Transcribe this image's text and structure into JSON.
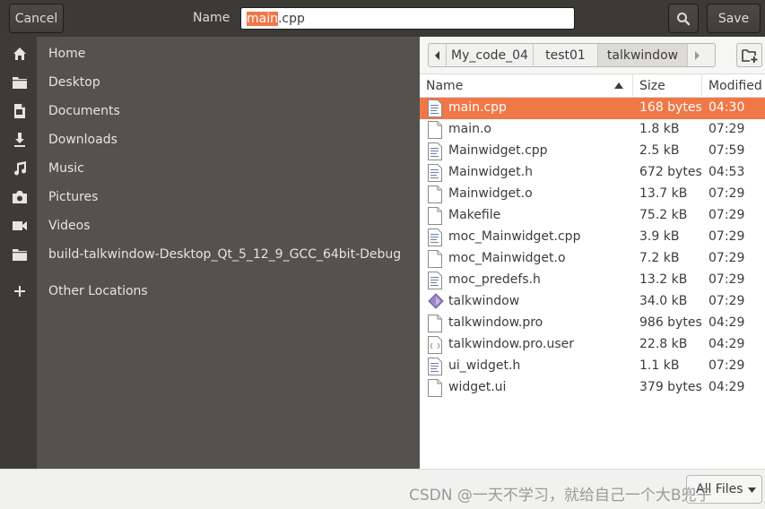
{
  "header": {
    "cancel_label": "Cancel",
    "name_label": "Name",
    "filename_selected": "main",
    "filename_rest": ".cpp",
    "save_label": "Save"
  },
  "sidebar": {
    "items": [
      {
        "label": "Home",
        "icon": "home-icon"
      },
      {
        "label": "Desktop",
        "icon": "folder-icon"
      },
      {
        "label": "Documents",
        "icon": "document-icon"
      },
      {
        "label": "Downloads",
        "icon": "download-icon"
      },
      {
        "label": "Music",
        "icon": "music-icon"
      },
      {
        "label": "Pictures",
        "icon": "camera-icon"
      },
      {
        "label": "Videos",
        "icon": "video-icon"
      },
      {
        "label": "build-talkwindow-Desktop_Qt_5_12_9_GCC_64bit-Debug",
        "icon": "folder-icon"
      },
      {
        "label": "Other Locations",
        "icon": "plus-icon"
      }
    ]
  },
  "pathbar": {
    "crumbs": [
      "My_code_04",
      "test01",
      "talkwindow"
    ],
    "active": "talkwindow"
  },
  "columns": {
    "name": "Name",
    "size": "Size",
    "modified": "Modified"
  },
  "files": [
    {
      "name": "main.cpp",
      "size": "168 bytes",
      "modified": "04:30",
      "icon": "text-file-icon"
    },
    {
      "name": "main.o",
      "size": "1.8 kB",
      "modified": "07:29",
      "icon": "blank-file-icon"
    },
    {
      "name": "Mainwidget.cpp",
      "size": "2.5 kB",
      "modified": "07:59",
      "icon": "text-file-icon"
    },
    {
      "name": "Mainwidget.h",
      "size": "672 bytes",
      "modified": "04:53",
      "icon": "text-file-icon"
    },
    {
      "name": "Mainwidget.o",
      "size": "13.7 kB",
      "modified": "07:29",
      "icon": "blank-file-icon"
    },
    {
      "name": "Makefile",
      "size": "75.2 kB",
      "modified": "07:29",
      "icon": "blank-file-icon"
    },
    {
      "name": "moc_Mainwidget.cpp",
      "size": "3.9 kB",
      "modified": "07:29",
      "icon": "text-file-icon"
    },
    {
      "name": "moc_Mainwidget.o",
      "size": "7.2 kB",
      "modified": "07:29",
      "icon": "blank-file-icon"
    },
    {
      "name": "moc_predefs.h",
      "size": "13.2 kB",
      "modified": "07:29",
      "icon": "text-file-icon"
    },
    {
      "name": "talkwindow",
      "size": "34.0 kB",
      "modified": "07:29",
      "icon": "executable-icon"
    },
    {
      "name": "talkwindow.pro",
      "size": "986 bytes",
      "modified": "04:29",
      "icon": "blank-file-icon"
    },
    {
      "name": "talkwindow.pro.user",
      "size": "22.8 kB",
      "modified": "04:29",
      "icon": "xml-file-icon"
    },
    {
      "name": "ui_widget.h",
      "size": "1.1 kB",
      "modified": "07:29",
      "icon": "text-file-icon"
    },
    {
      "name": "widget.ui",
      "size": "379 bytes",
      "modified": "04:29",
      "icon": "blank-file-icon"
    }
  ],
  "filter": {
    "label": "All Files"
  },
  "watermark": "CSDN @一天不学习，就给自己一个大B兜子",
  "colors": {
    "accent": "#f07746",
    "header_bg": "#3b3a37",
    "sidebar_bg": "#54524c"
  }
}
